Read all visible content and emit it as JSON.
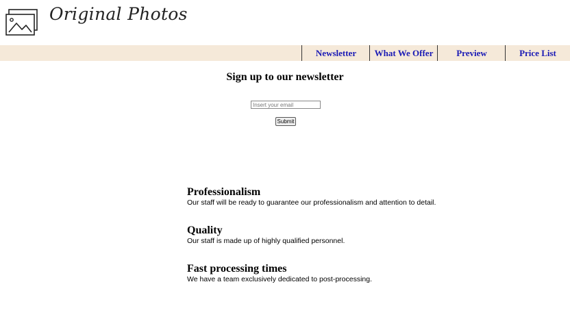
{
  "header": {
    "logo_text": "Original Photos",
    "logo_icon": "photos-icon"
  },
  "nav": {
    "items": [
      {
        "label": "Newsletter"
      },
      {
        "label": "What We Offer"
      },
      {
        "label": "Preview"
      },
      {
        "label": "Price List"
      }
    ]
  },
  "newsletter": {
    "title": "Sign up to our newsletter",
    "email_placeholder": "Insert your email",
    "email_value": "",
    "submit_label": "Submit"
  },
  "features": [
    {
      "title": "Professionalism",
      "description": "Our staff will be ready to guarantee our professionalism and attention to detail."
    },
    {
      "title": "Quality",
      "description": "Our staff is made up of highly qualified personnel."
    },
    {
      "title": "Fast processing times",
      "description": "We have a team exclusively dedicated to post-processing."
    }
  ],
  "colors": {
    "navbar_bg": "#f5e9d9",
    "nav_link": "#1a1ab5"
  }
}
